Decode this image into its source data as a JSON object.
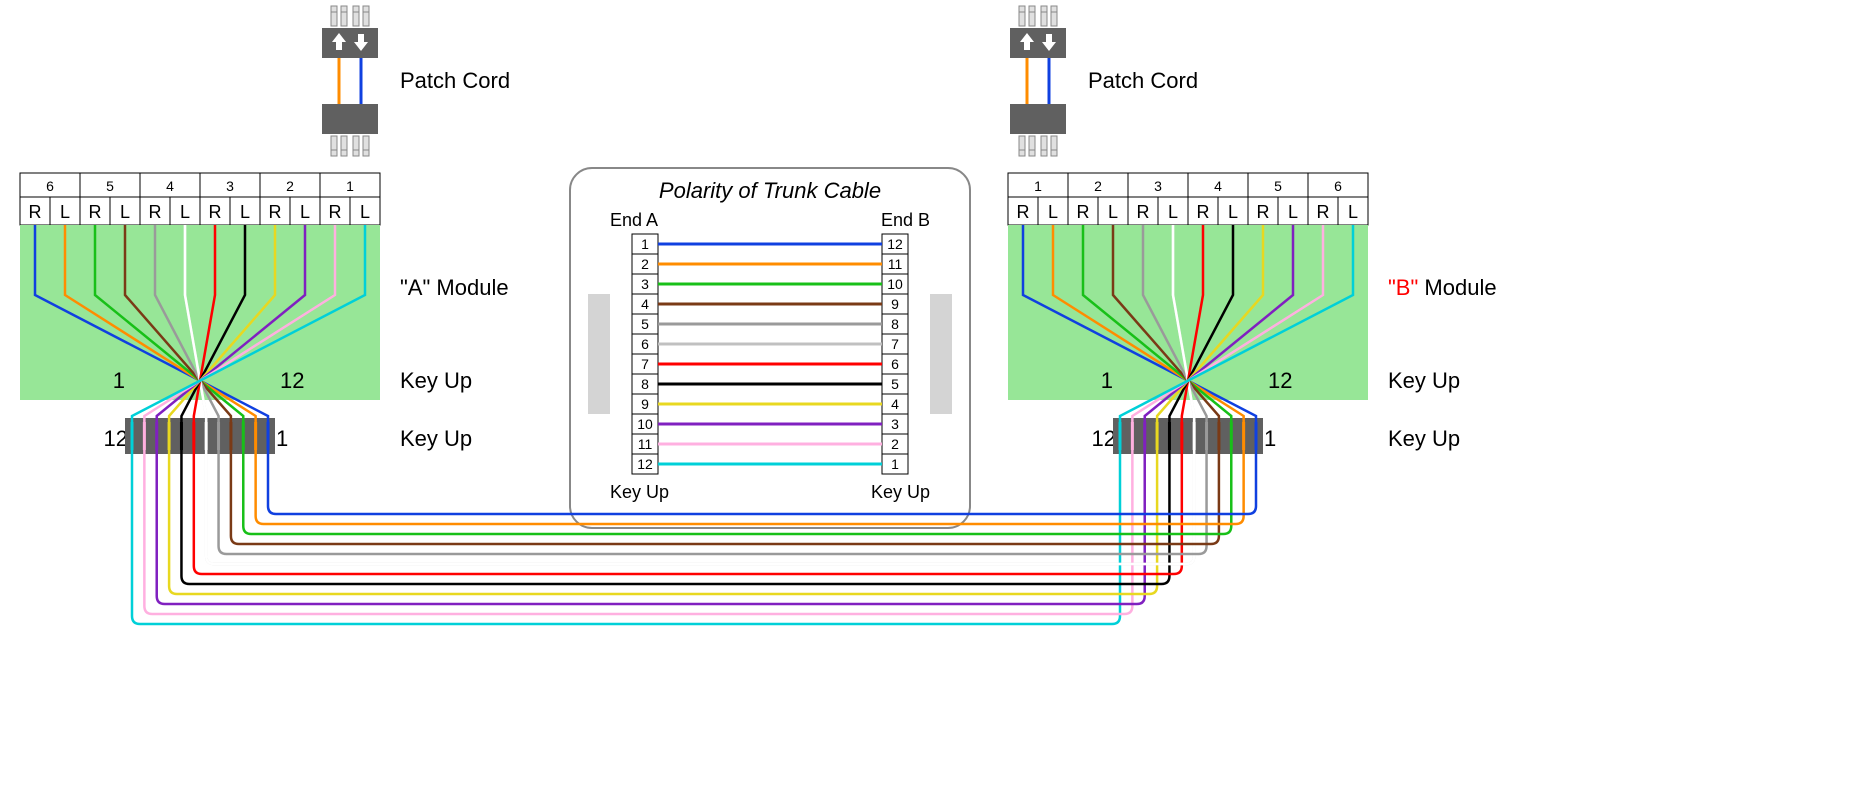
{
  "labels": {
    "patch_cord": "Patch Cord",
    "a_module": "\"A\" Module",
    "b_module_b": "\"B\"",
    "b_module_rest": " Module",
    "key_up": "Key Up",
    "polarity_title": "Polarity of Trunk Cable",
    "end_a": "End A",
    "end_b": "End B"
  },
  "ports_rl": [
    "R",
    "L",
    "R",
    "L",
    "R",
    "L",
    "R",
    "L",
    "R",
    "L",
    "R",
    "L"
  ],
  "left_port_nums": [
    "6",
    "5",
    "4",
    "3",
    "2",
    "1"
  ],
  "right_port_nums": [
    "1",
    "2",
    "3",
    "4",
    "5",
    "6"
  ],
  "conn_nums": {
    "1": "1",
    "12": "12"
  },
  "fiber_colors": [
    {
      "n": 1,
      "c": "#1040e0"
    },
    {
      "n": 2,
      "c": "#ff8c00"
    },
    {
      "n": 3,
      "c": "#18c018"
    },
    {
      "n": 4,
      "c": "#7a3a16"
    },
    {
      "n": 5,
      "c": "#9a9a9a"
    },
    {
      "n": 6,
      "c": "#ffffff",
      "stroke_outline": "#888"
    },
    {
      "n": 7,
      "c": "#ff0000"
    },
    {
      "n": 8,
      "c": "#000000"
    },
    {
      "n": 9,
      "c": "#e8d820"
    },
    {
      "n": 10,
      "c": "#8020c0"
    },
    {
      "n": 11,
      "c": "#ffb0e0"
    },
    {
      "n": 12,
      "c": "#00d0d8"
    }
  ],
  "trunk_pairs": [
    {
      "a": 1,
      "b": 12,
      "c": "#1040e0"
    },
    {
      "a": 2,
      "b": 11,
      "c": "#ff8c00"
    },
    {
      "a": 3,
      "b": 10,
      "c": "#18c018"
    },
    {
      "a": 4,
      "b": 9,
      "c": "#7a3a16"
    },
    {
      "a": 5,
      "b": 8,
      "c": "#9a9a9a"
    },
    {
      "a": 6,
      "b": 7,
      "c": "#c0c0c0"
    },
    {
      "a": 7,
      "b": 6,
      "c": "#ff0000"
    },
    {
      "a": 8,
      "b": 5,
      "c": "#000000"
    },
    {
      "a": 9,
      "b": 4,
      "c": "#e8d820"
    },
    {
      "a": 10,
      "b": 3,
      "c": "#8020c0"
    },
    {
      "a": 11,
      "b": 2,
      "c": "#ffb0e0"
    },
    {
      "a": 12,
      "b": 1,
      "c": "#00d0d8"
    }
  ]
}
